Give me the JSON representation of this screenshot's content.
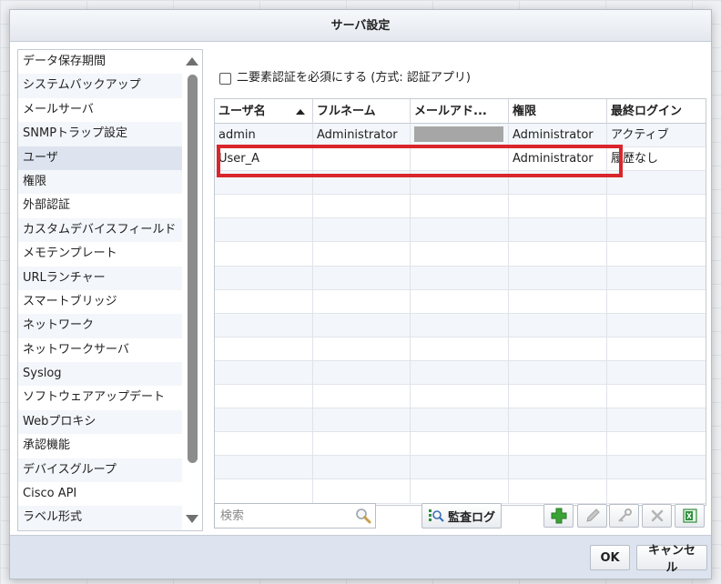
{
  "dialog": {
    "title": "サーバ設定"
  },
  "nav": {
    "items": [
      {
        "label": "データ保存期間"
      },
      {
        "label": "システムバックアップ"
      },
      {
        "label": "メールサーバ"
      },
      {
        "label": "SNMPトラップ設定"
      },
      {
        "label": "ユーザ",
        "selected": true
      },
      {
        "label": "権限"
      },
      {
        "label": "外部認証"
      },
      {
        "label": "カスタムデバイスフィールド"
      },
      {
        "label": "メモテンプレート"
      },
      {
        "label": "URLランチャー"
      },
      {
        "label": "スマートブリッジ"
      },
      {
        "label": "ネットワーク"
      },
      {
        "label": "ネットワークサーバ"
      },
      {
        "label": "Syslog"
      },
      {
        "label": "ソフトウェアアップデート"
      },
      {
        "label": "Webプロキシ"
      },
      {
        "label": "承認機能"
      },
      {
        "label": "デバイスグループ"
      },
      {
        "label": "Cisco API"
      },
      {
        "label": "ラベル形式"
      }
    ]
  },
  "two_factor": {
    "label": "二要素認証を必須にする (方式: 認証アプリ)",
    "checked": false
  },
  "users_table": {
    "columns": [
      "ユーザ名",
      "フルネーム",
      "メールアド...",
      "権限",
      "最終ログイン"
    ],
    "sort_column": "ユーザ名",
    "sort_direction": "asc",
    "rows": [
      {
        "username": "admin",
        "fullname": "Administrator",
        "email": "",
        "role": "Administrator",
        "last_login": "アクティブ"
      },
      {
        "username": "User_A",
        "fullname": "",
        "email": "",
        "role": "Administrator",
        "last_login": "履歴なし"
      }
    ],
    "empty_rows": 14
  },
  "toolbar": {
    "search_placeholder": "検索",
    "audit_log_label": "監査ログ"
  },
  "footer": {
    "ok_label": "OK",
    "cancel_label": "キャンセル"
  },
  "colors": {
    "highlight": "#d9262c",
    "selected_bg": "#dde4ef",
    "add_icon": "#3aa335"
  }
}
